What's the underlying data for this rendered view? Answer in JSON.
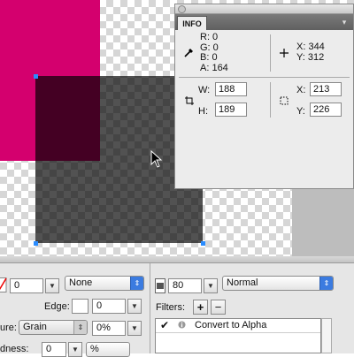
{
  "info_panel": {
    "tab_label": "INFO",
    "rgba": [
      "R: 0",
      "G: 0",
      "B: 0",
      "A: 164"
    ],
    "pointer_xy": [
      "X: 344",
      "Y: 312"
    ],
    "width_label": "W:",
    "width_value": "188",
    "height_label": "H:",
    "height_value": "189",
    "x_label": "X:",
    "x_value": "213",
    "y_label": "Y:",
    "y_value": "226"
  },
  "properties": {
    "stroke_size": "0",
    "edge_label": "Edge:",
    "edge_value": "0",
    "stroke_style": "None",
    "texture_label": "ure:",
    "texture_value": "Grain",
    "texture_percent": "0%",
    "softness_label": "dness:",
    "softness_value": "0",
    "softness_unit": "%",
    "opacity_value": "80",
    "blend_mode": "Normal",
    "filters_label": "Filters:",
    "add_filter": "+",
    "remove_filter": "−",
    "filter_items": [
      {
        "checked": "✔",
        "name": "Convert to Alpha"
      }
    ]
  },
  "colors": {
    "magenta": "#d4006e",
    "selection_handle": "#2a8cff",
    "popup_arrow": "#3b7be0"
  }
}
